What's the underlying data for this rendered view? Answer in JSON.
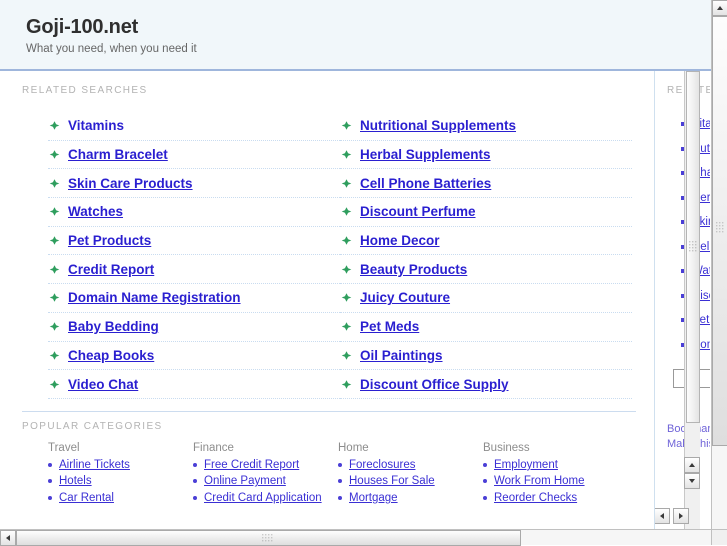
{
  "header": {
    "site_title": "Goji-100.net",
    "tagline": "What you need, when you need it"
  },
  "sections": {
    "related_searches_caption": "RELATED SEARCHES",
    "popular_categories_caption": "POPULAR CATEGORIES",
    "sidebar_caption": "RELATED"
  },
  "related_searches": {
    "left": [
      {
        "label": "Vitamins",
        "underlined": false
      },
      {
        "label": "Charm Bracelet",
        "underlined": true
      },
      {
        "label": "Skin Care Products",
        "underlined": true
      },
      {
        "label": "Watches",
        "underlined": true
      },
      {
        "label": "Pet Products",
        "underlined": true
      },
      {
        "label": "Credit Report",
        "underlined": true
      },
      {
        "label": "Domain Name Registration",
        "underlined": true
      },
      {
        "label": "Baby Bedding",
        "underlined": true
      },
      {
        "label": "Cheap Books",
        "underlined": true
      },
      {
        "label": "Video Chat",
        "underlined": true
      }
    ],
    "right": [
      {
        "label": "Nutritional Supplements",
        "underlined": true
      },
      {
        "label": "Herbal Supplements",
        "underlined": true
      },
      {
        "label": "Cell Phone Batteries",
        "underlined": true
      },
      {
        "label": "Discount Perfume",
        "underlined": true
      },
      {
        "label": "Home Decor",
        "underlined": true
      },
      {
        "label": "Beauty Products",
        "underlined": true
      },
      {
        "label": "Juicy Couture",
        "underlined": true
      },
      {
        "label": "Pet Meds",
        "underlined": true
      },
      {
        "label": "Oil Paintings",
        "underlined": true
      },
      {
        "label": "Discount Office Supply",
        "underlined": true
      }
    ]
  },
  "popular_categories": [
    {
      "title": "Travel",
      "links": [
        "Airline Tickets",
        "Hotels",
        "Car Rental"
      ]
    },
    {
      "title": "Finance",
      "links": [
        "Free Credit Report",
        "Online Payment",
        "Credit Card Application"
      ]
    },
    {
      "title": "Home",
      "links": [
        "Foreclosures",
        "Houses For Sale",
        "Mortgage"
      ]
    },
    {
      "title": "Business",
      "links": [
        "Employment",
        "Work From Home",
        "Reorder Checks"
      ]
    }
  ],
  "sidebar": {
    "items": [
      "Vitamins",
      "Nutritional Supplements",
      "Charm Bracelet",
      "Herbal Supplements",
      "Skin Care Products",
      "Cell Phone Batteries",
      "Watches",
      "Discount Perfume",
      "Pet Products",
      "Home Decor"
    ],
    "search_value": "",
    "search_placeholder": "",
    "footer_links": [
      "Bookmark this page",
      "Make this my homepage"
    ]
  },
  "colors": {
    "header_bg": "#f1f7fa",
    "header_border": "#9fb6dc",
    "link": "#2a1fd0",
    "bullet_green": "#2f9e5e",
    "caption_gray": "#b3b3b3",
    "dotted_rule": "#c9dcf0"
  }
}
